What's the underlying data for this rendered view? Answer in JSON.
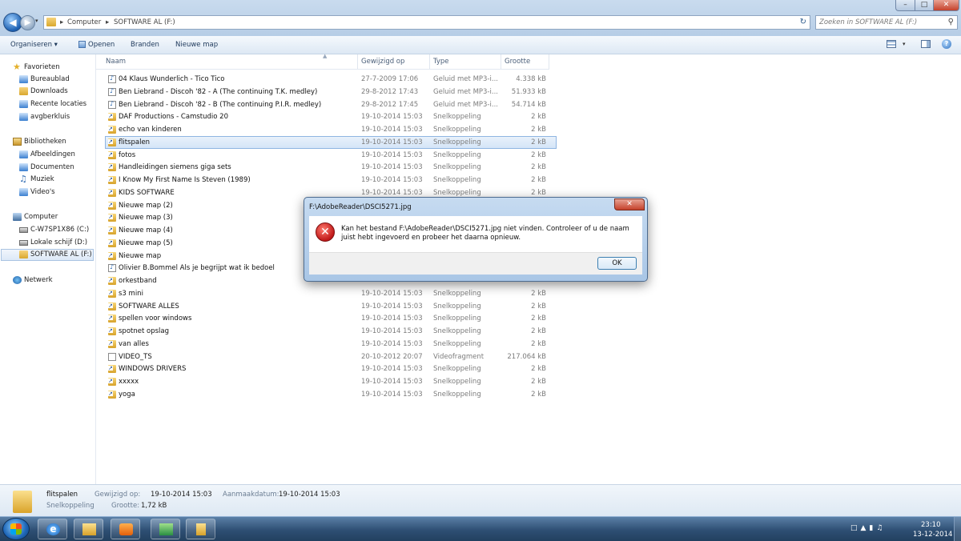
{
  "address": {
    "crumbs": [
      "Computer",
      "SOFTWARE AL (F:)"
    ],
    "sep": "▸"
  },
  "search": {
    "placeholder": "Zoeken in SOFTWARE AL (F:)"
  },
  "toolbar": {
    "organize": "Organiseren ▾",
    "open": "Openen",
    "burn": "Branden",
    "new_folder": "Nieuwe map"
  },
  "sidebar": {
    "favorites": "Favorieten",
    "fav_items": [
      "Bureaublad",
      "Downloads",
      "Recente locaties",
      "avgberkluis"
    ],
    "libraries": "Bibliotheken",
    "lib_items": [
      "Afbeeldingen",
      "Documenten",
      "Muziek",
      "Video's"
    ],
    "computer": "Computer",
    "drives": [
      "C-W7SP1X86 (C:)",
      "Lokale schijf (D:)",
      "SOFTWARE AL (F:)"
    ],
    "network": "Netwerk"
  },
  "columns": {
    "name": "Naam",
    "modified": "Gewijzigd op",
    "type": "Type",
    "size": "Grootte"
  },
  "files": [
    {
      "name": "04 Klaus Wunderlich - Tico Tico",
      "date": "27-7-2009 17:06",
      "type": "Geluid met MP3-i...",
      "size": "4.338 kB",
      "icon": "audio"
    },
    {
      "name": "Ben Liebrand - Discoh '82 - A (The continuing T.K. medley)",
      "date": "29-8-2012 17:43",
      "type": "Geluid met MP3-i...",
      "size": "51.933 kB",
      "icon": "audio"
    },
    {
      "name": "Ben Liebrand - Discoh '82 - B (The continuing P.I.R. medley)",
      "date": "29-8-2012 17:45",
      "type": "Geluid met MP3-i...",
      "size": "54.714 kB",
      "icon": "audio"
    },
    {
      "name": "DAF Productions - Camstudio 20",
      "date": "19-10-2014 15:03",
      "type": "Snelkoppeling",
      "size": "2 kB",
      "icon": "link"
    },
    {
      "name": "echo van kinderen",
      "date": "19-10-2014 15:03",
      "type": "Snelkoppeling",
      "size": "2 kB",
      "icon": "link"
    },
    {
      "name": "flitspalen",
      "date": "19-10-2014 15:03",
      "type": "Snelkoppeling",
      "size": "2 kB",
      "icon": "link"
    },
    {
      "name": "fotos",
      "date": "19-10-2014 15:03",
      "type": "Snelkoppeling",
      "size": "2 kB",
      "icon": "link"
    },
    {
      "name": "Handleidingen siemens giga sets",
      "date": "19-10-2014 15:03",
      "type": "Snelkoppeling",
      "size": "2 kB",
      "icon": "link"
    },
    {
      "name": "I Know My First Name Is Steven (1989)",
      "date": "19-10-2014 15:03",
      "type": "Snelkoppeling",
      "size": "2 kB",
      "icon": "link"
    },
    {
      "name": "KIDS SOFTWARE",
      "date": "19-10-2014 15:03",
      "type": "Snelkoppeling",
      "size": "2 kB",
      "icon": "link"
    },
    {
      "name": "Nieuwe map (2)",
      "date": "",
      "type": "",
      "size": "",
      "icon": "link"
    },
    {
      "name": "Nieuwe map (3)",
      "date": "",
      "type": "",
      "size": "",
      "icon": "link"
    },
    {
      "name": "Nieuwe map (4)",
      "date": "",
      "type": "",
      "size": "",
      "icon": "link"
    },
    {
      "name": "Nieuwe map (5)",
      "date": "",
      "type": "",
      "size": "",
      "icon": "link"
    },
    {
      "name": "Nieuwe map",
      "date": "",
      "type": "",
      "size": "",
      "icon": "link"
    },
    {
      "name": "Olivier B.Bommel Als je begrijpt wat ik bedoel",
      "date": "",
      "type": "",
      "size": "",
      "icon": "audio"
    },
    {
      "name": "orkestband",
      "date": "",
      "type": "",
      "size": "",
      "icon": "link"
    },
    {
      "name": "s3 mini",
      "date": "19-10-2014 15:03",
      "type": "Snelkoppeling",
      "size": "2 kB",
      "icon": "link"
    },
    {
      "name": "SOFTWARE ALLES",
      "date": "19-10-2014 15:03",
      "type": "Snelkoppeling",
      "size": "2 kB",
      "icon": "link"
    },
    {
      "name": "spellen voor windows",
      "date": "19-10-2014 15:03",
      "type": "Snelkoppeling",
      "size": "2 kB",
      "icon": "link"
    },
    {
      "name": "spotnet opslag",
      "date": "19-10-2014 15:03",
      "type": "Snelkoppeling",
      "size": "2 kB",
      "icon": "link"
    },
    {
      "name": "van alles",
      "date": "19-10-2014 15:03",
      "type": "Snelkoppeling",
      "size": "2 kB",
      "icon": "link"
    },
    {
      "name": "VIDEO_TS",
      "date": "20-10-2012 20:07",
      "type": "Videofragment",
      "size": "217.064 kB",
      "icon": "video"
    },
    {
      "name": "WINDOWS DRIVERS",
      "date": "19-10-2014 15:03",
      "type": "Snelkoppeling",
      "size": "2 kB",
      "icon": "link"
    },
    {
      "name": "xxxxx",
      "date": "19-10-2014 15:03",
      "type": "Snelkoppeling",
      "size": "2 kB",
      "icon": "link"
    },
    {
      "name": "yoga",
      "date": "19-10-2014 15:03",
      "type": "Snelkoppeling",
      "size": "2 kB",
      "icon": "link"
    }
  ],
  "selected_file": "flitspalen",
  "details": {
    "name": "flitspalen",
    "kind": "Snelkoppeling",
    "modified_label": "Gewijzigd op:",
    "modified": "19-10-2014 15:03",
    "created_label": "Aanmaakdatum:",
    "created": "19-10-2014 15:03",
    "size_label": "Grootte:",
    "size": "1,72 kB"
  },
  "dialog": {
    "title": "F:\\AdobeReader\\DSCI5271.jpg",
    "message": "Kan het bestand F:\\AdobeReader\\DSCI5271.jpg niet vinden. Controleer of u de naam juist hebt ingevoerd en probeer het daarna opnieuw.",
    "ok": "OK",
    "close": "✕"
  },
  "taskbar": {
    "time": "23:10",
    "date": "13-12-2014"
  },
  "colors": {
    "accent": "#1f67b8",
    "selection": "#d3e4f7",
    "error": "#c01919"
  }
}
